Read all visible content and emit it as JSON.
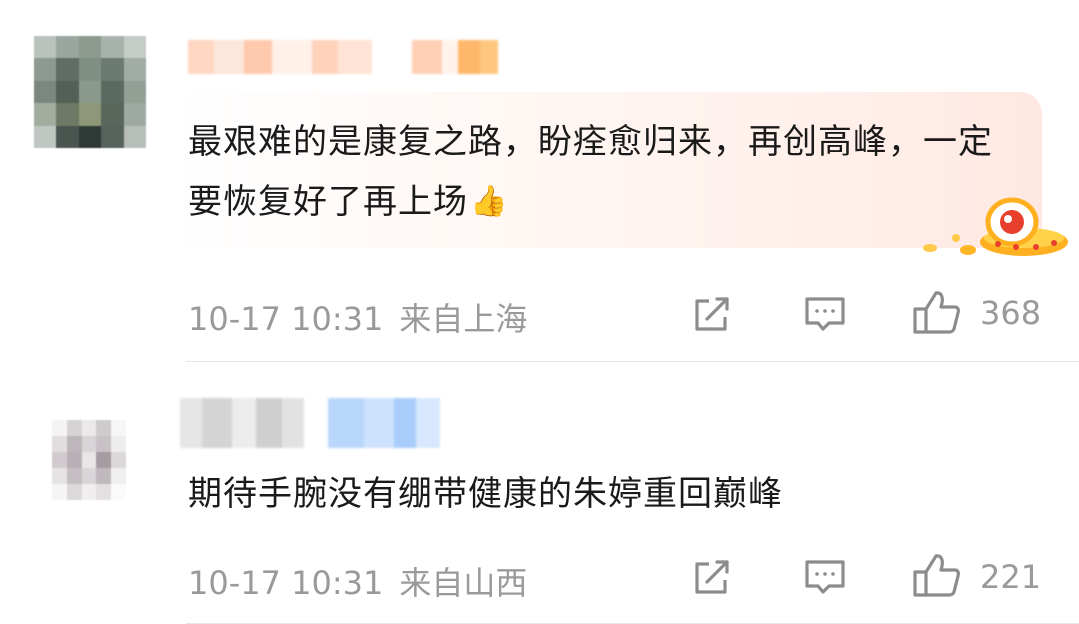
{
  "comments": [
    {
      "text": "最艰难的是康复之路，盼痊愈归来，再创高峰，一定要恢复好了再上场",
      "emoji": "👍",
      "time": "10-17 10:31",
      "location": "来自上海",
      "likes": "368",
      "icons": [
        "share-icon",
        "comment-icon",
        "thumbs-up-icon",
        "ufo-mascot-icon"
      ]
    },
    {
      "text": "期待手腕没有绷带健康的朱婷重回巅峰",
      "time": "10-17 10:31",
      "location": "来自山西",
      "likes": "221",
      "icons": [
        "share-icon",
        "comment-icon",
        "thumbs-up-icon"
      ]
    }
  ],
  "colors": {
    "text": "#1a1a1a",
    "meta": "#9a9a9a",
    "bubble_accent": "#ffe8e2",
    "divider": "#e8e8e8"
  }
}
